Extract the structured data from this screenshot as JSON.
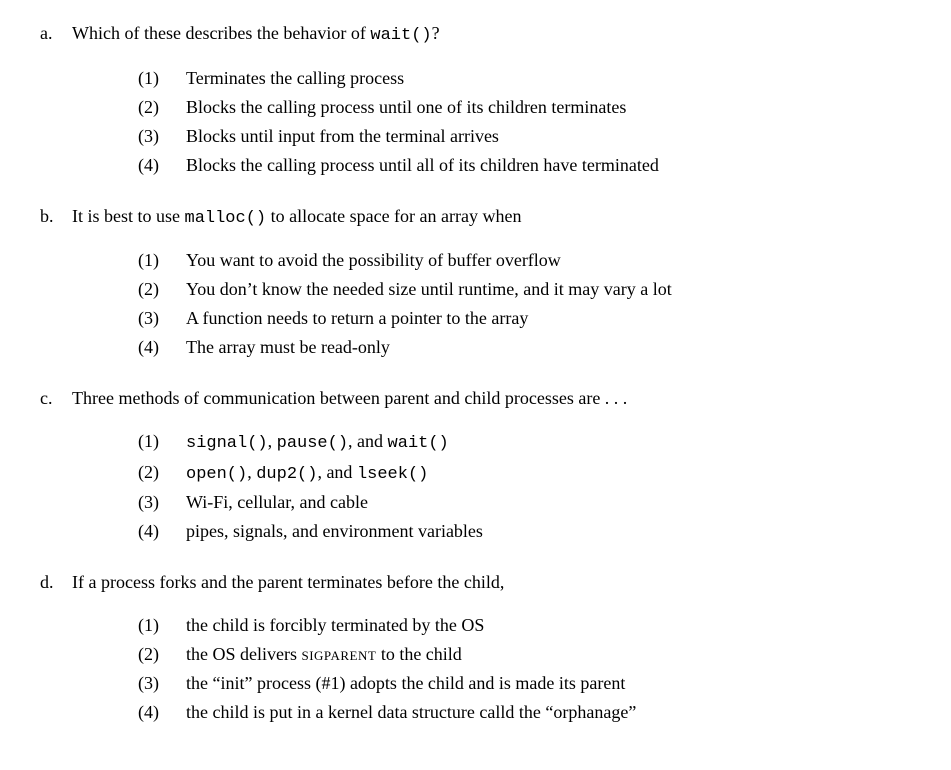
{
  "questions": [
    {
      "letter": "a.",
      "text_pre": "Which of these describes the behavior of ",
      "text_code": "wait()",
      "text_post": "?",
      "options": [
        {
          "num": "(1)",
          "text": "Terminates the calling process"
        },
        {
          "num": "(2)",
          "text": "Blocks the calling process until one of its children terminates"
        },
        {
          "num": "(3)",
          "text": "Blocks until input from the terminal arrives"
        },
        {
          "num": "(4)",
          "text": "Blocks the calling process until all of its children have terminated"
        }
      ]
    },
    {
      "letter": "b.",
      "text_pre": "It is best to use ",
      "text_code": "malloc()",
      "text_post": " to allocate space for an array when",
      "options": [
        {
          "num": "(1)",
          "text": "You want to avoid the possibility of buffer overflow"
        },
        {
          "num": "(2)",
          "text": "You don’t know the needed size until runtime, and it may vary a lot"
        },
        {
          "num": "(3)",
          "text": "A function needs to return a pointer to the array"
        },
        {
          "num": "(4)",
          "text": "The array must be read-only"
        }
      ]
    },
    {
      "letter": "c.",
      "text_pre": "Three methods of communication between parent and child processes are . . .",
      "text_code": "",
      "text_post": "",
      "options": [
        {
          "num": "(1)",
          "segments": [
            {
              "code": true,
              "t": "signal()"
            },
            {
              "code": false,
              "t": ", "
            },
            {
              "code": true,
              "t": "pause()"
            },
            {
              "code": false,
              "t": ", and "
            },
            {
              "code": true,
              "t": "wait()"
            }
          ]
        },
        {
          "num": "(2)",
          "segments": [
            {
              "code": true,
              "t": "open()"
            },
            {
              "code": false,
              "t": ", "
            },
            {
              "code": true,
              "t": "dup2()"
            },
            {
              "code": false,
              "t": ", and "
            },
            {
              "code": true,
              "t": "lseek()"
            }
          ]
        },
        {
          "num": "(3)",
          "text": "Wi-Fi, cellular, and cable"
        },
        {
          "num": "(4)",
          "text": "pipes, signals, and environment variables"
        }
      ]
    },
    {
      "letter": "d.",
      "text_pre": "If a process forks and the parent terminates before the child,",
      "text_code": "",
      "text_post": "",
      "options": [
        {
          "num": "(1)",
          "text": "the child is forcibly terminated by the OS"
        },
        {
          "num": "(2)",
          "segments": [
            {
              "code": false,
              "t": "the OS delivers "
            },
            {
              "sc": true,
              "t": "sigparent"
            },
            {
              "code": false,
              "t": " to the child"
            }
          ]
        },
        {
          "num": "(3)",
          "text": "the “init” process (#1) adopts the child and is made its parent"
        },
        {
          "num": "(4)",
          "text": "the child is put in a kernel data structure calld the “orphanage”"
        }
      ]
    }
  ]
}
